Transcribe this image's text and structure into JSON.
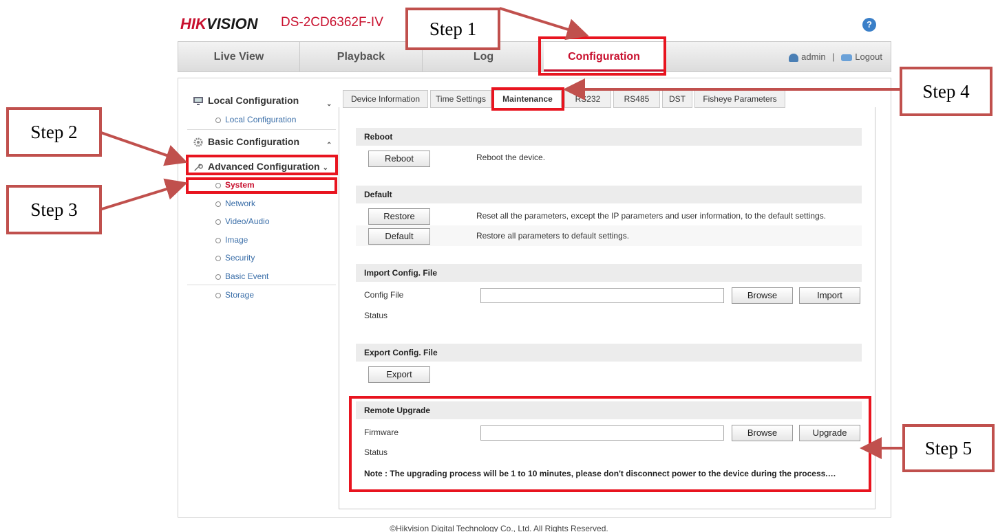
{
  "header": {
    "brand_red": "HIK",
    "brand_dark": "VISION",
    "model": "DS-2CD6362F-IV",
    "help": "?"
  },
  "nav": {
    "tabs": [
      "Live View",
      "Playback",
      "Log",
      "Configuration"
    ],
    "user": "admin",
    "separator": "|",
    "logout": "Logout"
  },
  "sidebar": {
    "local_hdr": "Local Configuration",
    "local_item": "Local Configuration",
    "basic_hdr": "Basic Configuration",
    "advanced_hdr": "Advanced Configuration",
    "items": [
      "System",
      "Network",
      "Video/Audio",
      "Image",
      "Security",
      "Basic Event",
      "Storage"
    ]
  },
  "subtabs": [
    "Device Information",
    "Time Settings",
    "Maintenance",
    "RS232",
    "RS485",
    "DST",
    "Fisheye Parameters"
  ],
  "reboot": {
    "title": "Reboot",
    "button": "Reboot",
    "desc": "Reboot the device."
  },
  "default": {
    "title": "Default",
    "restore_button": "Restore",
    "restore_desc": "Reset all the parameters, except the IP parameters and user information, to the default settings.",
    "default_button": "Default",
    "default_desc": "Restore all parameters to default settings."
  },
  "import": {
    "title": "Import Config. File",
    "file_label": "Config File",
    "browse": "Browse",
    "import": "Import",
    "status": "Status"
  },
  "export": {
    "title": "Export Config. File",
    "button": "Export"
  },
  "upgrade": {
    "title": "Remote Upgrade",
    "firmware_label": "Firmware",
    "browse": "Browse",
    "upgrade": "Upgrade",
    "status": "Status",
    "note": "Note :  The upgrading process will be 1 to 10 minutes, please don't disconnect power to the device during the process.…"
  },
  "annotations": [
    "Step 1",
    "Step 2",
    "Step 3",
    "Step 4",
    "Step 5"
  ],
  "footer": "©Hikvision Digital Technology Co., Ltd. All Rights Reserved.",
  "colors": {
    "brand_red": "#c8102e",
    "annotation_red": "#e8141f",
    "arrow": "#c0504d",
    "link_blue": "#3a6ea8"
  }
}
